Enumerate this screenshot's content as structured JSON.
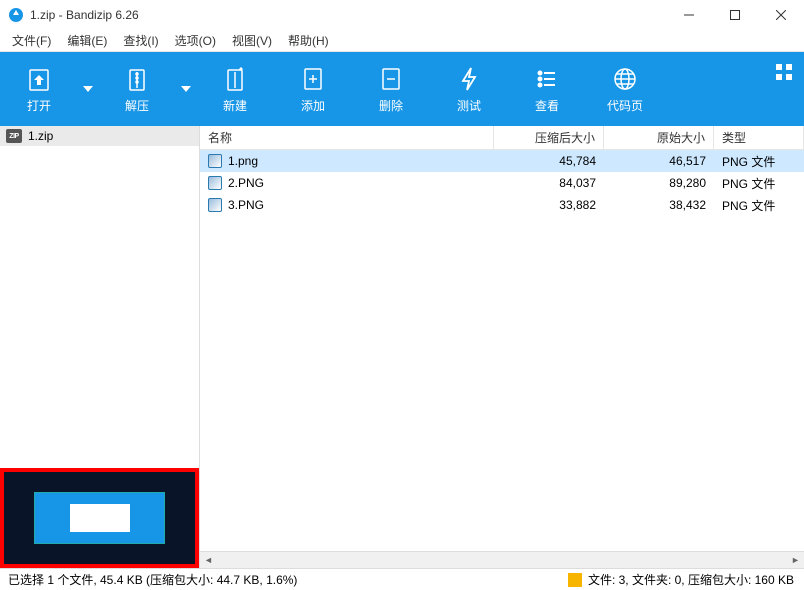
{
  "title": "1.zip - Bandizip 6.26",
  "menus": [
    {
      "label": "文件(F)"
    },
    {
      "label": "编辑(E)"
    },
    {
      "label": "查找(I)"
    },
    {
      "label": "选项(O)"
    },
    {
      "label": "视图(V)"
    },
    {
      "label": "帮助(H)"
    }
  ],
  "toolbar": {
    "open": "打开",
    "extract": "解压",
    "new": "新建",
    "add": "添加",
    "delete": "删除",
    "test": "测试",
    "view": "查看",
    "codepage": "代码页"
  },
  "tree": {
    "root": "1.zip"
  },
  "columns": {
    "name": "名称",
    "compressed": "压缩后大小",
    "original": "原始大小",
    "type": "类型"
  },
  "files": [
    {
      "name": "1.png",
      "compressed": "45,784",
      "original": "46,517",
      "type": "PNG 文件",
      "selected": true
    },
    {
      "name": "2.PNG",
      "compressed": "84,037",
      "original": "89,280",
      "type": "PNG 文件",
      "selected": false
    },
    {
      "name": "3.PNG",
      "compressed": "33,882",
      "original": "38,432",
      "type": "PNG 文件",
      "selected": false
    }
  ],
  "status": {
    "left": "已选择 1 个文件, 45.4 KB (压缩包大小: 44.7 KB, 1.6%)",
    "right": "文件: 3, 文件夹: 0, 压缩包大小: 160 KB"
  }
}
